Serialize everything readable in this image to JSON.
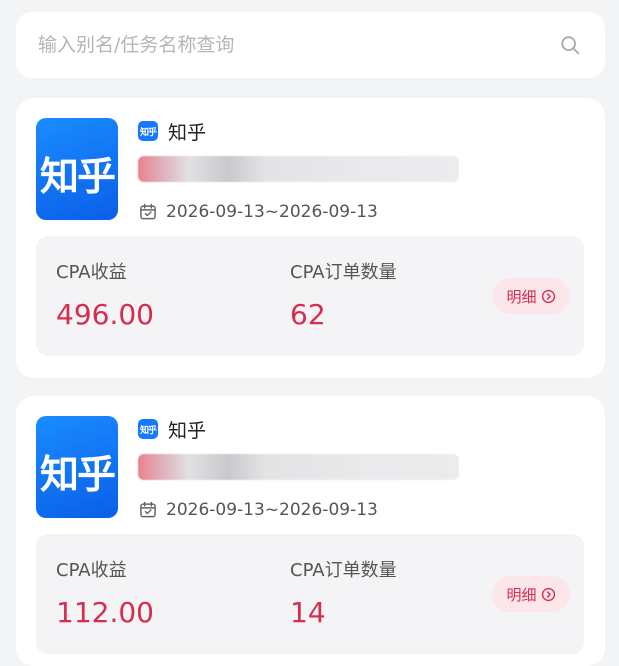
{
  "search": {
    "placeholder": "输入别名/任务名称查询"
  },
  "cards": [
    {
      "logo_text": "知乎",
      "platform_badge": "知乎",
      "platform_name": "知乎",
      "date_range": "2026-09-13~2026-09-13",
      "stats": {
        "revenue_label": "CPA收益",
        "revenue_value": "496.00",
        "orders_label": "CPA订单数量",
        "orders_value": "62"
      },
      "detail_label": "明细"
    },
    {
      "logo_text": "知乎",
      "platform_badge": "知乎",
      "platform_name": "知乎",
      "date_range": "2026-09-13~2026-09-13",
      "stats": {
        "revenue_label": "CPA收益",
        "revenue_value": "112.00",
        "orders_label": "CPA订单数量",
        "orders_value": "14"
      },
      "detail_label": "明细"
    }
  ],
  "colors": {
    "accent": "#d62d4f",
    "logo_blue": "#0f6ff0",
    "page_bg": "#f3f4f6"
  },
  "icons": {
    "search": "search-icon",
    "calendar": "calendar-icon",
    "detail": "chevron-right-circle-icon"
  }
}
